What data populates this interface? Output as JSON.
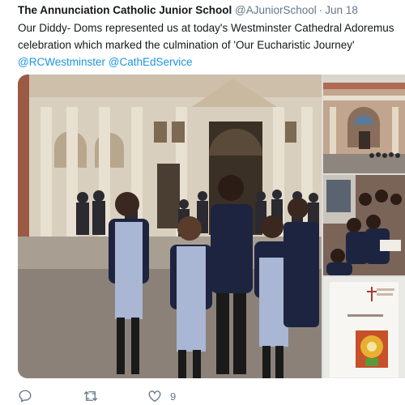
{
  "tweet": {
    "author": "The Annunciation Catholic Junior School",
    "handle": "@AJuniorSchool",
    "separator": "·",
    "date": "Jun 18",
    "text_line1": "Our Diddy- Doms represented us at today's Westminster Cathedral Adoremus",
    "text_line2": "celebration which marked the culmination of 'Our Eucharistic Journey'",
    "mention1": "@RCWestminster",
    "mention2": "@CathEdService",
    "like_count": "9"
  },
  "media": {
    "count": 4,
    "images": [
      "children-outside-cathedral",
      "cathedral-facade",
      "children-seated-in-cathedral",
      "eucharistic-journey-booklet"
    ],
    "booklet": {
      "cover_line": "OUR EUCHARISTIC JOURNEY"
    }
  },
  "actions": {
    "icons": [
      "reply-icon",
      "retweet-icon",
      "like-icon"
    ]
  },
  "colors": {
    "text": "#14171a",
    "secondary": "#657786",
    "link": "#1b95e0"
  }
}
